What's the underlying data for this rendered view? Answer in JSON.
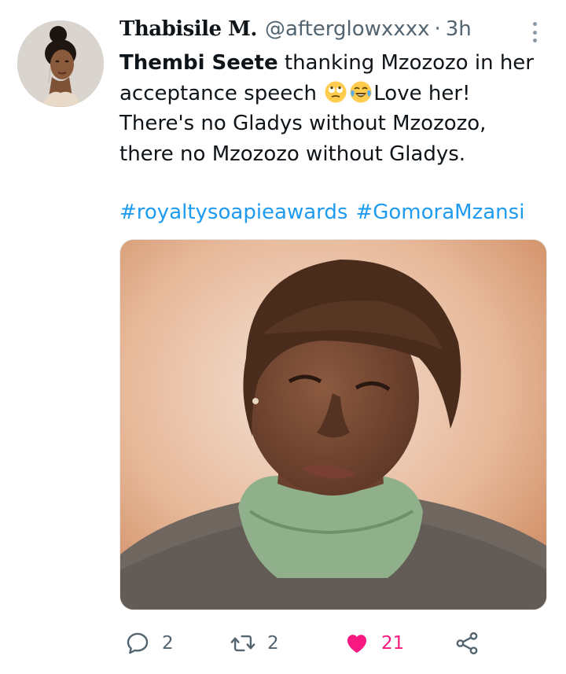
{
  "tweet": {
    "display_name": "Thabisile M.",
    "handle": "@afterglowxxxx",
    "separator": "·",
    "time": "3h",
    "text": {
      "line1_bold": "Thembi Seete",
      "line1_rest": " thanking Mzozozo in her",
      "line2_start": "acceptance speech ",
      "line2_end": "Love her!",
      "line3": "There's no Gladys without Mzozozo,",
      "line4": "there no Mzozozo without Gladys."
    },
    "emojis": [
      "face-with-rolling-eyes-emoji",
      "loudly-crying-laughing-emoji"
    ],
    "hashtags": [
      "#royaltysoapieawards",
      "#GomoraMzansi"
    ]
  },
  "actions": {
    "replies": "2",
    "retweets": "2",
    "likes": "21",
    "liked": true,
    "like_color": "#f91880"
  },
  "colors": {
    "link": "#1d9bf0",
    "muted": "#536471"
  }
}
